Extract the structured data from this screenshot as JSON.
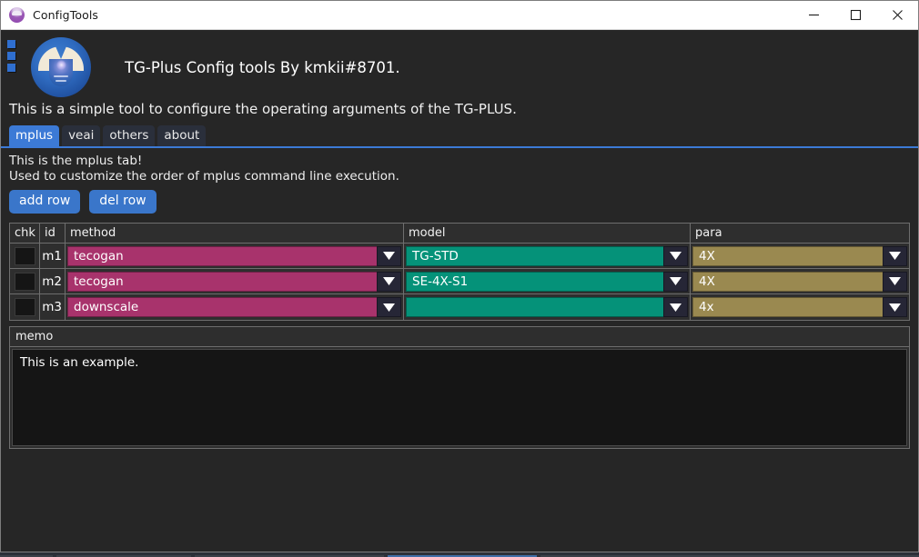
{
  "window": {
    "title": "ConfigTools",
    "icon": "app-circle-icon",
    "controls": {
      "minimize": "minimize-icon",
      "maximize": "maximize-icon",
      "close": "close-icon"
    }
  },
  "header": {
    "logo": "tg-plus-logo",
    "grip": "grip-handle-icon",
    "title": "TG-Plus Config tools By kmkii#8701.",
    "subtitle": "This is a simple tool to configure the operating arguments of the TG-PLUS."
  },
  "tabs": {
    "items": [
      {
        "label": "mplus",
        "active": true
      },
      {
        "label": "veai",
        "active": false
      },
      {
        "label": "others",
        "active": false
      },
      {
        "label": "about",
        "active": false
      }
    ]
  },
  "tab_body": {
    "line1": "This is the mplus tab!",
    "line2": "Used to customize the order of mplus command line execution.",
    "buttons": [
      {
        "label": "add row",
        "name": "add-row-button"
      },
      {
        "label": "del row",
        "name": "del-row-button"
      }
    ]
  },
  "grid": {
    "columns": [
      "chk",
      "id",
      "method",
      "model",
      "para"
    ],
    "rows": [
      {
        "chk": false,
        "id": "m1",
        "method": "tecogan",
        "model": "TG-STD",
        "para": "4X"
      },
      {
        "chk": false,
        "id": "m2",
        "method": "tecogan",
        "model": "SE-4X-S1",
        "para": "4X"
      },
      {
        "chk": false,
        "id": "m3",
        "method": "downscale",
        "model": "",
        "para": "4x"
      }
    ],
    "dropdown_icon": "chevron-down-icon"
  },
  "memo": {
    "header": "memo",
    "text": "This is an example."
  },
  "colors": {
    "accent_blue": "#3c7ad6",
    "method_magenta": "#a8336c",
    "model_teal": "#059279",
    "para_tan": "#9a8950",
    "window_bg": "#262626",
    "titlebar_bg": "#ffffff"
  }
}
